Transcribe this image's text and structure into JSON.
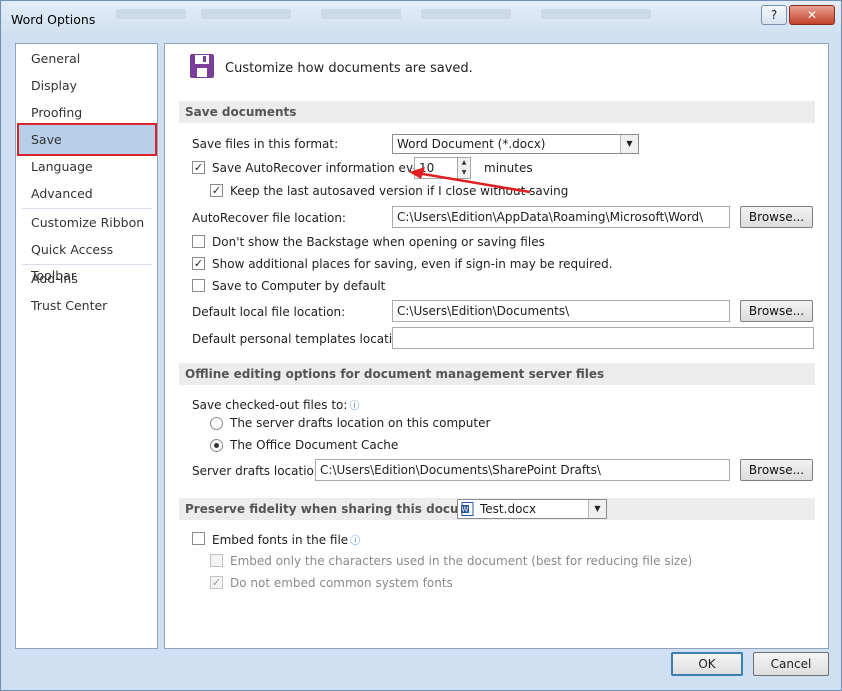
{
  "window": {
    "title": "Word Options",
    "help_glyph": "?",
    "close_glyph": "✕"
  },
  "sidebar": {
    "items": [
      {
        "label": "General"
      },
      {
        "label": "Display"
      },
      {
        "label": "Proofing"
      },
      {
        "label": "Save",
        "selected": true
      },
      {
        "label": "Language"
      },
      {
        "label": "Advanced"
      },
      {
        "label": "Customize Ribbon"
      },
      {
        "label": "Quick Access Toolbar"
      },
      {
        "label": "Add-Ins"
      },
      {
        "label": "Trust Center"
      }
    ]
  },
  "main": {
    "header_icon": "save-disk-icon",
    "header_text": "Customize how documents are saved.",
    "save_documents": {
      "section_title": "Save documents",
      "format_label": "Save files in this format:",
      "format_value": "Word Document (*.docx)",
      "autorecover_label": "Save AutoRecover information every",
      "autorecover_checked": true,
      "autorecover_minutes": "10",
      "minutes_label": "minutes",
      "keep_last_label": "Keep the last autosaved version if I close without saving",
      "keep_last_checked": true,
      "autorecover_location_label": "AutoRecover file location:",
      "autorecover_location_value": "C:\\Users\\Edition\\AppData\\Roaming\\Microsoft\\Word\\",
      "browse_label": "Browse...",
      "backstage_label": "Don't show the Backstage when opening or saving files",
      "backstage_checked": false,
      "additional_places_label": "Show additional places for saving, even if sign-in may be required.",
      "additional_places_checked": true,
      "save_to_computer_label": "Save to Computer by default",
      "save_to_computer_checked": false,
      "default_local_label": "Default local file location:",
      "default_local_value": "C:\\Users\\Edition\\Documents\\",
      "default_templates_label": "Default personal templates location:",
      "default_templates_value": ""
    },
    "offline": {
      "section_title": "Offline editing options for document management server files",
      "save_checked_out_label": "Save checked-out files to:",
      "radio_server_label": "The server drafts location on this computer",
      "radio_cache_label": "The Office Document Cache",
      "selected": "cache",
      "server_drafts_label": "Server drafts location:",
      "server_drafts_value": "C:\\Users\\Edition\\Documents\\SharePoint Drafts\\",
      "browse_label": "Browse..."
    },
    "fidelity": {
      "section_title": "Preserve fidelity when sharing this document:",
      "document_value": "Test.docx",
      "embed_fonts_label": "Embed fonts in the file",
      "embed_fonts_checked": false,
      "embed_only_label": "Embed only the characters used in the document (best for reducing file size)",
      "embed_only_checked": false,
      "do_not_embed_label": "Do not embed common system fonts",
      "do_not_embed_checked": true
    }
  },
  "footer": {
    "ok_label": "OK",
    "cancel_label": "Cancel"
  },
  "colors": {
    "selected_outline": "#d9232a",
    "annotation_arrow": "#e02020",
    "selection_bg": "#b8cfe9"
  },
  "glyphs": {
    "check": "✓",
    "dropdown": "▼",
    "up": "▲",
    "down": "▼",
    "info": "ⓘ"
  }
}
